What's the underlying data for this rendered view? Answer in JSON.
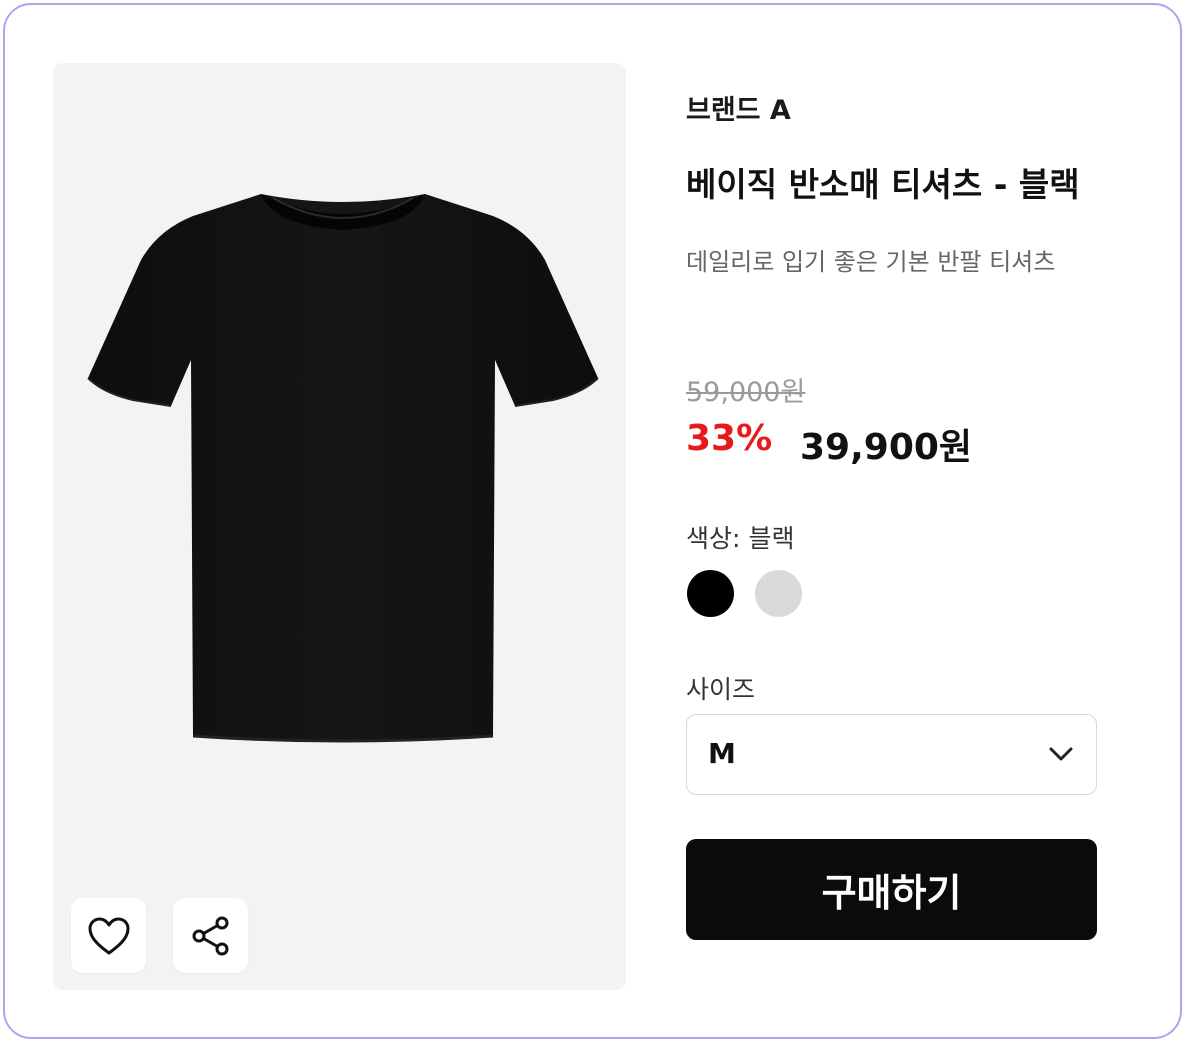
{
  "product": {
    "brand": "브랜드 A",
    "name": "베이직 반소매 티셔츠 - 블랙",
    "description": "데일리로 입기 좋은 기본 반팔 티셔츠"
  },
  "pricing": {
    "original_price": "59,000원",
    "discount_rate": "33%",
    "sale_price": "39,900원"
  },
  "color": {
    "label": "색상:",
    "selected": "블랙",
    "options": [
      {
        "name": "블랙",
        "hex": "#000000"
      },
      {
        "name": "light-gray",
        "hex": "#d9d9d9"
      }
    ]
  },
  "size": {
    "label": "사이즈",
    "selected": "M"
  },
  "buy_button": {
    "label": "구매하기"
  },
  "icons": {
    "like": "heart-icon",
    "share": "share-icon",
    "dropdown": "chevron-down-icon"
  },
  "colors": {
    "accent_discount": "#e8191c",
    "buy_button_bg": "#0b0b0c",
    "card_border": "#a9a7e8"
  }
}
